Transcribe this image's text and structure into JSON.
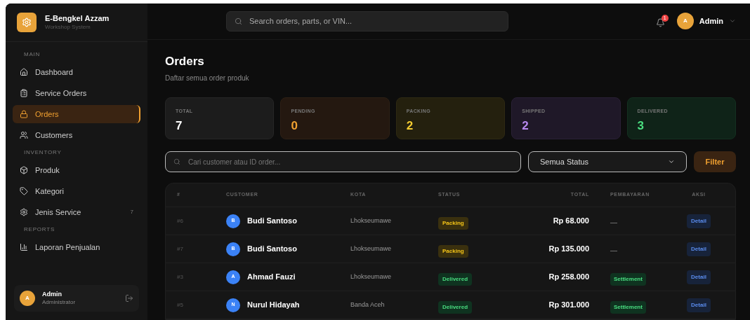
{
  "brand": {
    "name": "E-Bengkel Azzam",
    "subtitle": "Workshop System"
  },
  "sidebar": {
    "sections": [
      {
        "title": "MAIN",
        "items": [
          {
            "label": "Dashboard",
            "selected": false
          },
          {
            "label": "Service Orders",
            "selected": false
          },
          {
            "label": "Orders",
            "selected": true
          },
          {
            "label": "Customers",
            "selected": false
          }
        ]
      },
      {
        "title": "INVENTORY",
        "items": [
          {
            "label": "Produk",
            "selected": false
          },
          {
            "label": "Kategori",
            "selected": false
          },
          {
            "label": "Jenis Service",
            "selected": false,
            "count": "7"
          }
        ]
      },
      {
        "title": "REPORTS",
        "items": [
          {
            "label": "Laporan Penjualan",
            "selected": false
          }
        ]
      }
    ]
  },
  "user_card": {
    "avatar": "A",
    "name": "Admin",
    "role": "Administrator"
  },
  "header": {
    "search": {
      "placeholder": "Search orders, parts, or VIN..."
    },
    "notifications": "1",
    "user": {
      "avatar": "A",
      "name": "Admin"
    }
  },
  "page": {
    "title": "Orders",
    "subtitle": "Daftar semua order produk"
  },
  "stats": [
    {
      "label": "TOTAL",
      "value": "7",
      "kind": "total"
    },
    {
      "label": "PENDING",
      "value": "0",
      "kind": "pending"
    },
    {
      "label": "PACKING",
      "value": "2",
      "kind": "packing"
    },
    {
      "label": "SHIPPED",
      "value": "2",
      "kind": "shipped"
    },
    {
      "label": "DELIVERED",
      "value": "3",
      "kind": "delivered"
    }
  ],
  "filters": {
    "search": {
      "placeholder": "Cari customer atau ID order..."
    },
    "status": {
      "value": "Semua Status"
    },
    "button": "Filter"
  },
  "table": {
    "columns": [
      "#",
      "CUSTOMER",
      "KOTA",
      "STATUS",
      "TOTAL",
      "PEMBAYARAN",
      "AKSI"
    ],
    "rows": [
      {
        "id": "#6",
        "avatar": "B",
        "customer": "Budi Santoso",
        "city": "Lhokseumawe",
        "status": {
          "label": "Packing",
          "kind": "packing"
        },
        "total": "Rp 68.000",
        "payment": {
          "label": "—",
          "kind": "none"
        },
        "action": "Detail"
      },
      {
        "id": "#7",
        "avatar": "B",
        "customer": "Budi Santoso",
        "city": "Lhokseumawe",
        "status": {
          "label": "Packing",
          "kind": "packing"
        },
        "total": "Rp 135.000",
        "payment": {
          "label": "—",
          "kind": "none"
        },
        "action": "Detail"
      },
      {
        "id": "#3",
        "avatar": "A",
        "customer": "Ahmad Fauzi",
        "city": "Lhokseumawe",
        "status": {
          "label": "Delivered",
          "kind": "delivered"
        },
        "total": "Rp 258.000",
        "payment": {
          "label": "Settlement",
          "kind": "settlement"
        },
        "action": "Detail"
      },
      {
        "id": "#5",
        "avatar": "N",
        "customer": "Nurul Hidayah",
        "city": "Banda Aceh",
        "status": {
          "label": "Delivered",
          "kind": "delivered"
        },
        "total": "Rp 301.000",
        "payment": {
          "label": "Settlement",
          "kind": "settlement"
        },
        "action": "Detail"
      }
    ]
  }
}
